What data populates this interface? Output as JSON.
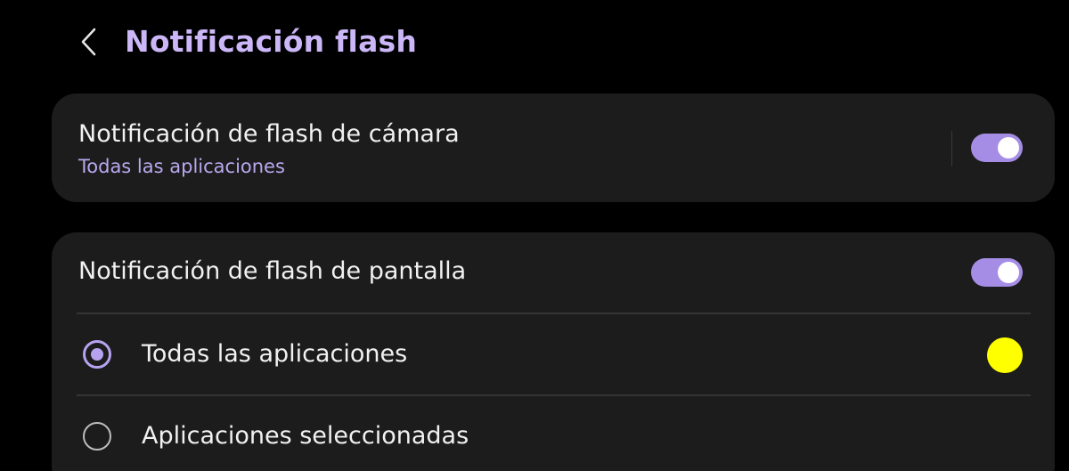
{
  "header": {
    "title": "Notificación flash",
    "back_icon": "chevron-left-icon"
  },
  "camera_flash": {
    "title": "Notificación de flash de cámara",
    "subtitle": "Todas las aplicaciones",
    "enabled": true
  },
  "screen_flash": {
    "title": "Notificación de flash de pantalla",
    "enabled": true,
    "options": [
      {
        "label": "Todas las aplicaciones",
        "selected": true
      },
      {
        "label": "Aplicaciones seleccionadas",
        "selected": false
      }
    ],
    "selected_color": "#ffff00"
  },
  "colors": {
    "accent": "#a58de6",
    "title": "#cbb7f7",
    "subtitle": "#b9a8ee",
    "card_background": "#1c1c1c",
    "background": "#000000"
  }
}
